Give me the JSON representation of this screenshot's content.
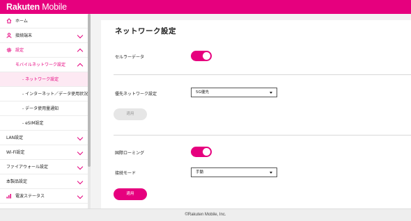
{
  "header": {
    "brand_bold": "Rakuten",
    "brand_regular": " Mobile",
    "brand_color": "#e6007e"
  },
  "sidebar": {
    "items": [
      {
        "label": "ホーム"
      },
      {
        "label": "接続端末"
      },
      {
        "label": "設定"
      },
      {
        "label": "モバイルネットワーク設定"
      },
      {
        "label": "- ネットワーク設定"
      },
      {
        "label": "- インターネット／データ使用状況"
      },
      {
        "label": "- データ使用量通知"
      },
      {
        "label": "- eSIM設定"
      },
      {
        "label": "LAN設定"
      },
      {
        "label": "Wi-Fi設定"
      },
      {
        "label": "ファイアウォール設定"
      },
      {
        "label": "本製品設定"
      },
      {
        "label": "電波ステータス"
      }
    ]
  },
  "main": {
    "title": "ネットワーク設定",
    "cellular_label": "セルラーデータ",
    "cellular_on": true,
    "preferred_label": "優先ネットワーク設定",
    "preferred_value": "5G優先",
    "apply1_label": "適用",
    "roaming_label": "国際ローミング",
    "roaming_on": true,
    "mode_label": "接続モード",
    "mode_value": "手動",
    "apply2_label": "適用"
  },
  "footer": {
    "copyright": "©Rakuten Mobile, Inc."
  }
}
